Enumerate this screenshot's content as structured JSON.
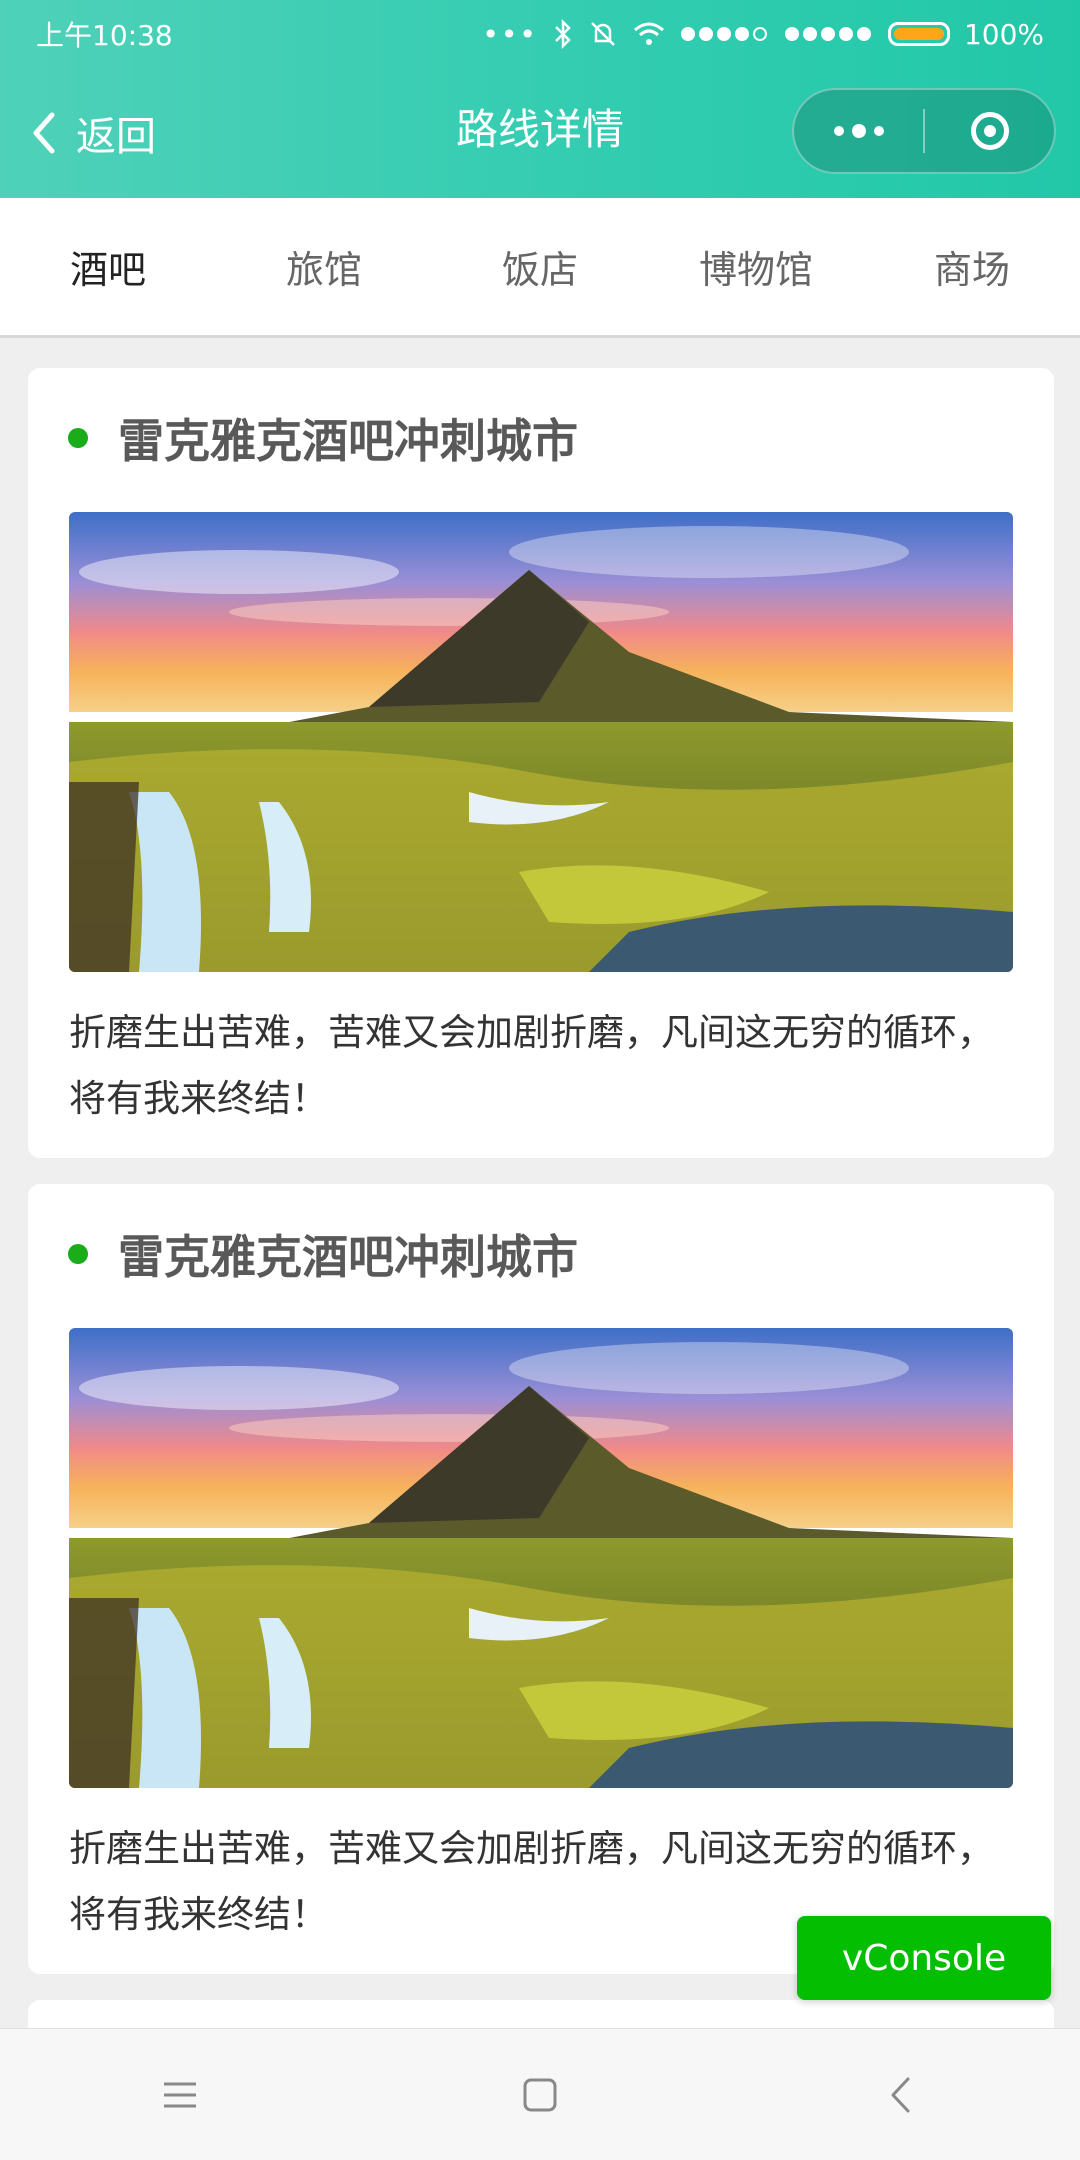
{
  "status_bar": {
    "time": "上午10:38",
    "battery": "100%"
  },
  "nav": {
    "back_label": "返回",
    "title": "路线详情"
  },
  "tabs": [
    {
      "label": "酒吧"
    },
    {
      "label": "旅馆"
    },
    {
      "label": "饭店"
    },
    {
      "label": "博物馆"
    },
    {
      "label": "商场"
    }
  ],
  "cards": [
    {
      "title": "雷克雅克酒吧冲刺城市",
      "text": "折磨生出苦难，苦难又会加剧折磨，凡间这无穷的循环，将有我来终结！"
    },
    {
      "title": "雷克雅克酒吧冲刺城市",
      "text": "折磨生出苦难，苦难又会加剧折磨，凡间这无穷的循环，将有我来终结！"
    }
  ],
  "vconsole": {
    "label": "vConsole"
  },
  "colors": {
    "header_gradient_start": "#4fd1b9",
    "header_gradient_end": "#21c8a8",
    "bullet": "#1aad19",
    "vconsole": "#04be02",
    "battery": "#ffa51a"
  },
  "icons": {
    "back": "chevron-left-icon",
    "more": "more-dots-icon",
    "close": "target-circle-icon",
    "menu": "menu-lines-icon",
    "home": "square-home-icon",
    "sys_back": "chevron-left-icon"
  }
}
